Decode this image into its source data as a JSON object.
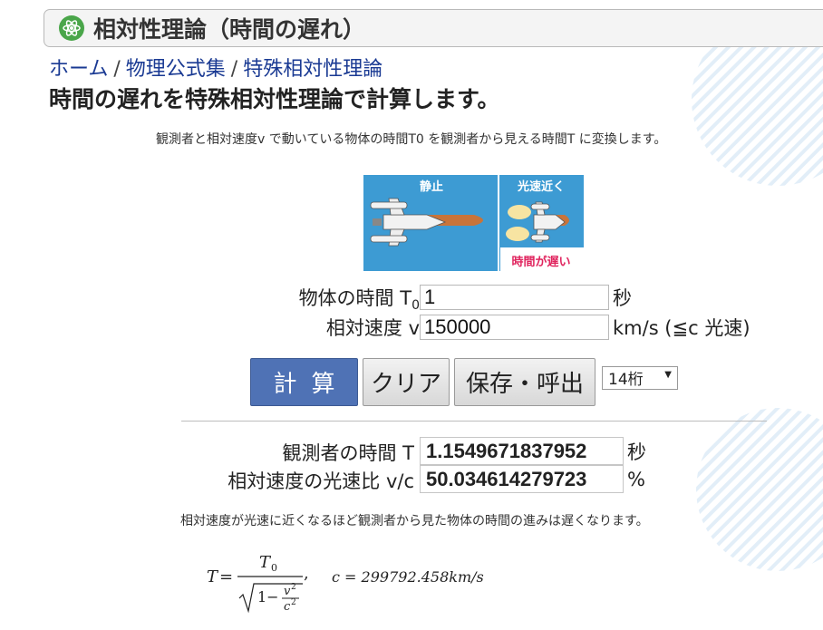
{
  "title": "相対性理論（時間の遅れ）",
  "breadcrumb": {
    "items": [
      "ホーム",
      "物理公式集",
      "特殊相対性理論"
    ],
    "separator": "/"
  },
  "heading": "時間の遅れを特殊相対性理論で計算します。",
  "description": "観測者と相対速度v で動いている物体の時間T0 を観測者から見える時間T に変換します。",
  "illustration": {
    "left_label": "静止",
    "right_label": "光速近く",
    "caption": "時間が遅い"
  },
  "inputs": {
    "t0": {
      "label": "物体の時間 T",
      "label_sub": "0",
      "value": "1",
      "unit": "秒"
    },
    "v": {
      "label": "相対速度 v",
      "value": "150000",
      "unit": "km/s (≦c 光速)"
    }
  },
  "buttons": {
    "calc": "計算",
    "clear": "クリア",
    "save": "保存・呼出"
  },
  "digits": {
    "selected": "14桁"
  },
  "results": {
    "t": {
      "label": "観測者の時間 T",
      "value": "1.1549671837952",
      "unit": "秒"
    },
    "ratio": {
      "label": "相対速度の光速比 v/c",
      "value": "50.034614279723",
      "unit": "%"
    }
  },
  "note": "相対速度が光速に近くなるほど観測者から見た物体の時間の進みは遅くなります。",
  "formula": {
    "lhs": "T",
    "equals": "=",
    "numerator": "T",
    "numerator_sub": "0",
    "one_minus": "1−",
    "v_term": "v",
    "c_term": "c",
    "power": "2",
    "comma": ",",
    "c_def": "c = 299792.458km/s"
  },
  "colors": {
    "accent_button": "#4f72b5",
    "link": "#1a3a93",
    "illustration_bg": "#3d9bd3",
    "title_icon": "#4aa64a"
  }
}
